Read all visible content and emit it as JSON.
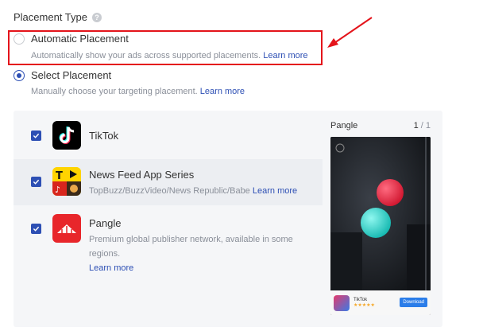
{
  "placement": {
    "title": "Placement Type",
    "help_icon": "question-circle-icon",
    "options": [
      {
        "label": "Automatic Placement",
        "description": "Automatically show your ads across supported placements.",
        "link": "Learn more",
        "selected": false
      },
      {
        "label": "Select Placement",
        "description": "Manually choose your targeting placement.",
        "link": "Learn more",
        "selected": true
      }
    ]
  },
  "placements": [
    {
      "name": "TikTok",
      "checked": true,
      "icon": "tiktok-logo-icon",
      "subtitle": "",
      "link": ""
    },
    {
      "name": "News Feed App Series",
      "checked": true,
      "icon": "news-feed-logo-icon",
      "subtitle": "TopBuzz/BuzzVideo/News Republic/Babe",
      "link": "Learn more"
    },
    {
      "name": "Pangle",
      "checked": true,
      "icon": "pangle-logo-icon",
      "subtitle": "Premium global publisher network, available in some regions.",
      "link": "Learn more"
    }
  ],
  "preview": {
    "title": "Pangle",
    "page_current": "1",
    "page_sep": "/",
    "page_total": "1",
    "ad_app_name": "TikTok",
    "ad_rating": "★★★★★",
    "ad_cta": "Download"
  },
  "colors": {
    "accent": "#2d4fb4",
    "highlight": "#e4141b",
    "panel_bg": "#f5f6f8"
  }
}
